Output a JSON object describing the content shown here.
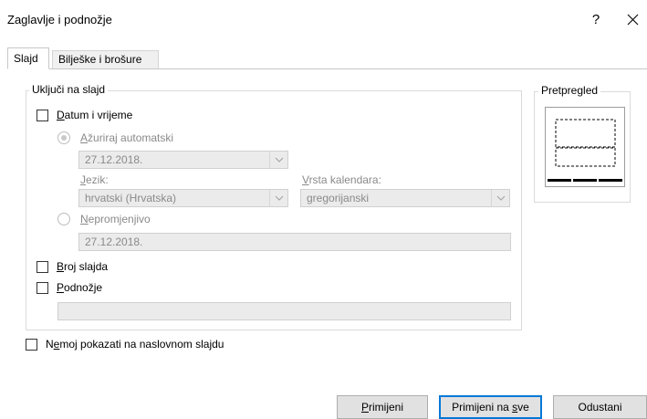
{
  "dialog": {
    "title": "Zaglavlje i podnožje",
    "help_glyph": "?",
    "close_glyph": "✕"
  },
  "tabs": [
    {
      "label": "Slajd",
      "active": true
    },
    {
      "label": "Bilješke i brošure",
      "active": false
    }
  ],
  "include_group": {
    "label": "Uključi na slajd",
    "date_time": {
      "label_u": "D",
      "label_rest": "atum i vrijeme",
      "checked": false
    },
    "auto_update": {
      "label_u": "A",
      "label_rest": "žuriraj automatski",
      "selected": true,
      "value": "27.12.2018."
    },
    "language": {
      "label_u": "J",
      "label_rest": "ezik:",
      "value": "hrvatski (Hrvatska)"
    },
    "calendar": {
      "label_u": "V",
      "label_rest": "rsta kalendara:",
      "value": "gregorijanski"
    },
    "fixed": {
      "label_u": "N",
      "label_rest": "epromjenjivo",
      "selected": false,
      "value": "27.12.2018."
    },
    "slide_number": {
      "label_u": "B",
      "label_rest": "roj slajda",
      "checked": false
    },
    "footer": {
      "label_u": "P",
      "label_rest": "odnožje",
      "checked": false,
      "value": ""
    }
  },
  "dont_show_title": {
    "label_pre": "N",
    "label_u": "e",
    "label_rest": "moj pokazati na naslovnom slajdu",
    "checked": false
  },
  "preview": {
    "label": "Pretpregled"
  },
  "buttons": {
    "apply": {
      "u": "P",
      "rest": "rimijeni"
    },
    "apply_all": {
      "pre": "Primijeni na ",
      "u": "s",
      "rest": "ve"
    },
    "cancel": "Odustani"
  },
  "colors": {
    "accent": "#0078d7",
    "disabled_bg": "#ebebeb"
  }
}
